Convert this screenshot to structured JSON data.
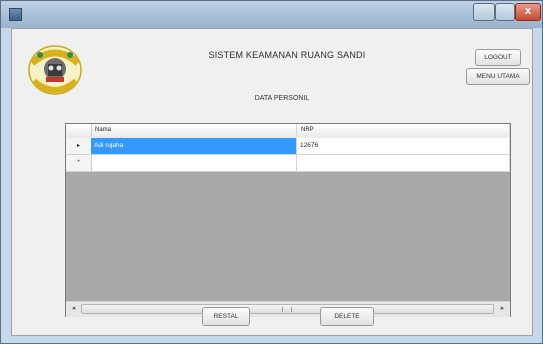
{
  "window": {
    "title": "",
    "accent": "#c6d8ea"
  },
  "header": {
    "title": "SISTEM KEAMANAN RUANG SANDI",
    "subtitle": "DATA PERSONIL",
    "logo_icon": "emblem-icon"
  },
  "buttons": {
    "logout": "LOGOUT",
    "menu_utama": "MENU UTAMA",
    "reset": "RESTAL",
    "delete": "DELETE"
  },
  "table": {
    "columns": [
      "Nama",
      "NRP"
    ],
    "rows": [
      {
        "indicator": "▸",
        "nama": "Adi rujaha",
        "nrp": "12676",
        "selected": true
      },
      {
        "indicator": "*",
        "nama": "",
        "nrp": "",
        "selected": false
      }
    ]
  },
  "colors": {
    "selection": "#3399ff",
    "grid_background": "#a9a9a9"
  }
}
